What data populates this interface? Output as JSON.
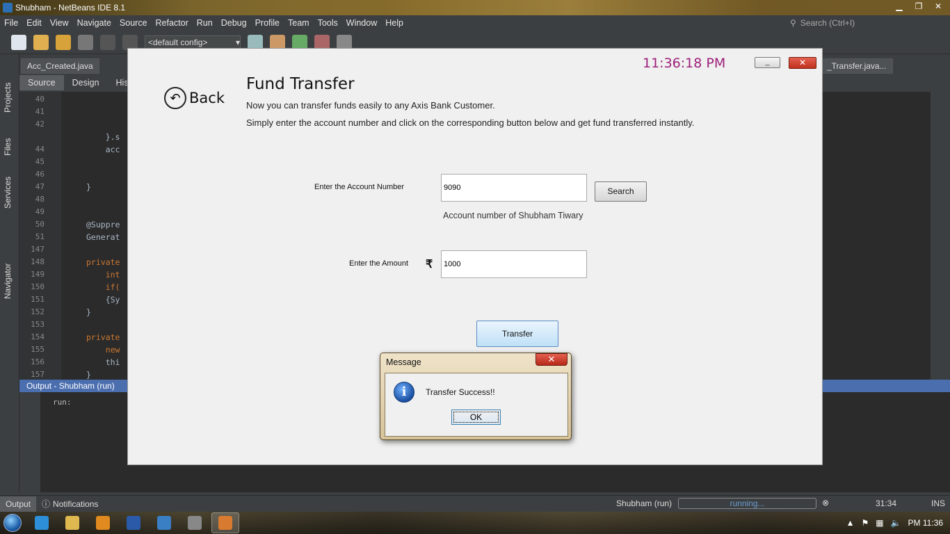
{
  "ide": {
    "window_title": "Shubham - NetBeans IDE 8.1",
    "menu": [
      "File",
      "Edit",
      "View",
      "Navigate",
      "Source",
      "Refactor",
      "Run",
      "Debug",
      "Profile",
      "Team",
      "Tools",
      "Window",
      "Help"
    ],
    "search_placeholder": "Search (Ctrl+I)",
    "config": "<default config>",
    "side_panels": [
      "Projects",
      "Files",
      "Services",
      "Navigator"
    ],
    "editor_tabs": [
      "Acc_Created.java",
      "_Transfer.java..."
    ],
    "editor_subtabs": [
      "Source",
      "Design",
      "His"
    ],
    "code_lines": [
      {
        "n": "40",
        "t": ""
      },
      {
        "n": "41",
        "t": ""
      },
      {
        "n": "42",
        "t": ""
      },
      {
        "n": "",
        "t": "    }.s"
      },
      {
        "n": "44",
        "t": "    acc"
      },
      {
        "n": "45",
        "t": ""
      },
      {
        "n": "46",
        "t": ""
      },
      {
        "n": "47",
        "t": "}"
      },
      {
        "n": "48",
        "t": ""
      },
      {
        "n": "49",
        "t": ""
      },
      {
        "n": "50",
        "t": "@Suppre"
      },
      {
        "n": "51",
        "t": "Generat"
      },
      {
        "n": "147",
        "t": ""
      },
      {
        "n": "148",
        "t": "private"
      },
      {
        "n": "149",
        "t": "    int"
      },
      {
        "n": "150",
        "t": "    if("
      },
      {
        "n": "151",
        "t": "    {Sy"
      },
      {
        "n": "152",
        "t": "}"
      },
      {
        "n": "153",
        "t": ""
      },
      {
        "n": "154",
        "t": "private"
      },
      {
        "n": "155",
        "t": "    new"
      },
      {
        "n": "156",
        "t": "    thi"
      },
      {
        "n": "157",
        "t": "}"
      }
    ],
    "output_title": "Output - Shubham (run)",
    "output_text": "run:",
    "status_tabs": [
      "Output",
      "Notifications"
    ],
    "status_project": "Shubham (run)",
    "status_progress": "running...",
    "cursor_pos": "31:34",
    "insert_mode": "INS"
  },
  "app": {
    "clock": "11:36:18 PM",
    "minimize_label": "_",
    "close_label": "✕",
    "back_label": "Back",
    "heading": "Fund Transfer",
    "subtitle1": "Now you can transfer funds easily to any Axis Bank Customer.",
    "subtitle2": "Simply enter the account number and click on the corresponding button below and get fund transferred instantly.",
    "account_label": "Enter the Account Number",
    "account_value": "9090",
    "search_button": "Search",
    "account_holder": "Account number of Shubham  Tiwary",
    "amount_label": "Enter the Amount",
    "currency_symbol": "₹",
    "amount_value": "1000",
    "transfer_button": "Transfer"
  },
  "dialog": {
    "title": "Message",
    "message": "Transfer Success!!",
    "ok_label": "OK",
    "close_label": "✕"
  },
  "taskbar": {
    "clock": "PM 11:36"
  }
}
